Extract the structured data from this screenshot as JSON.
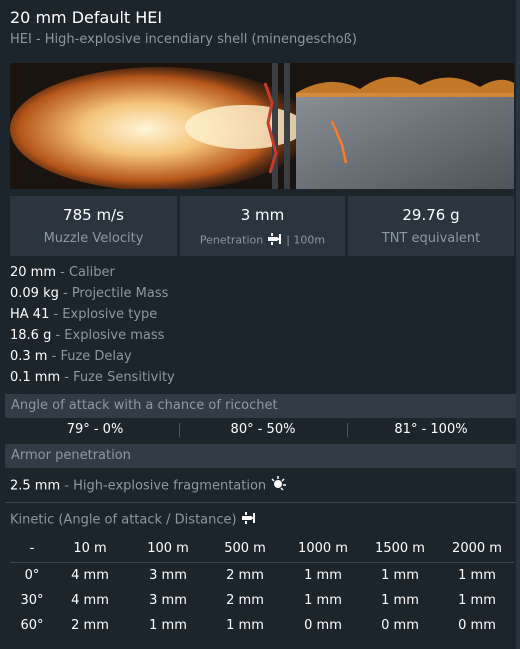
{
  "header": {
    "title": "20 mm Default HEI",
    "subtitle": "HEI - High-explosive incendiary shell (minengeschoß)"
  },
  "stats": [
    {
      "value": "785 m/s",
      "label": "Muzzle Velocity"
    },
    {
      "value": "3 mm",
      "label": "Penetration",
      "suffix": "| 100m"
    },
    {
      "value": "29.76 g",
      "label": "TNT equivalent"
    }
  ],
  "properties": [
    {
      "value": "20 mm",
      "label": "- Caliber"
    },
    {
      "value": "0.09 kg",
      "label": "- Projectile Mass"
    },
    {
      "value": "HA 41",
      "label": "- Explosive type"
    },
    {
      "value": "18.6 g",
      "label": "- Explosive mass"
    },
    {
      "value": "0.3 m",
      "label": "- Fuze Delay"
    },
    {
      "value": "0.1 mm",
      "label": "- Fuze Sensitivity"
    }
  ],
  "ricochet": {
    "title": "Angle of attack with a chance of ricochet",
    "values": [
      "79° - 0%",
      "80° - 50%",
      "81° - 100%"
    ]
  },
  "armor": {
    "title": "Armor penetration",
    "fragmentation": {
      "value": "2.5 mm",
      "label": "- High-explosive fragmentation"
    }
  },
  "kinetic": {
    "title": "Kinetic (Angle of attack / Distance)",
    "headers": [
      "-",
      "10 m",
      "100 m",
      "500 m",
      "1000 m",
      "1500 m",
      "2000 m"
    ],
    "rows": [
      {
        "angle": "0°",
        "values": [
          "4 mm",
          "3 mm",
          "2 mm",
          "1 mm",
          "1 mm",
          "1 mm"
        ]
      },
      {
        "angle": "30°",
        "values": [
          "4 mm",
          "3 mm",
          "2 mm",
          "1 mm",
          "1 mm",
          "1 mm"
        ]
      },
      {
        "angle": "60°",
        "values": [
          "2 mm",
          "1 mm",
          "1 mm",
          "0 mm",
          "0 mm",
          "0 mm"
        ]
      }
    ]
  },
  "icons": {
    "penetration": "shell-target-icon",
    "fragmentation": "explosion-icon",
    "kinetic": "shell-target-icon"
  }
}
